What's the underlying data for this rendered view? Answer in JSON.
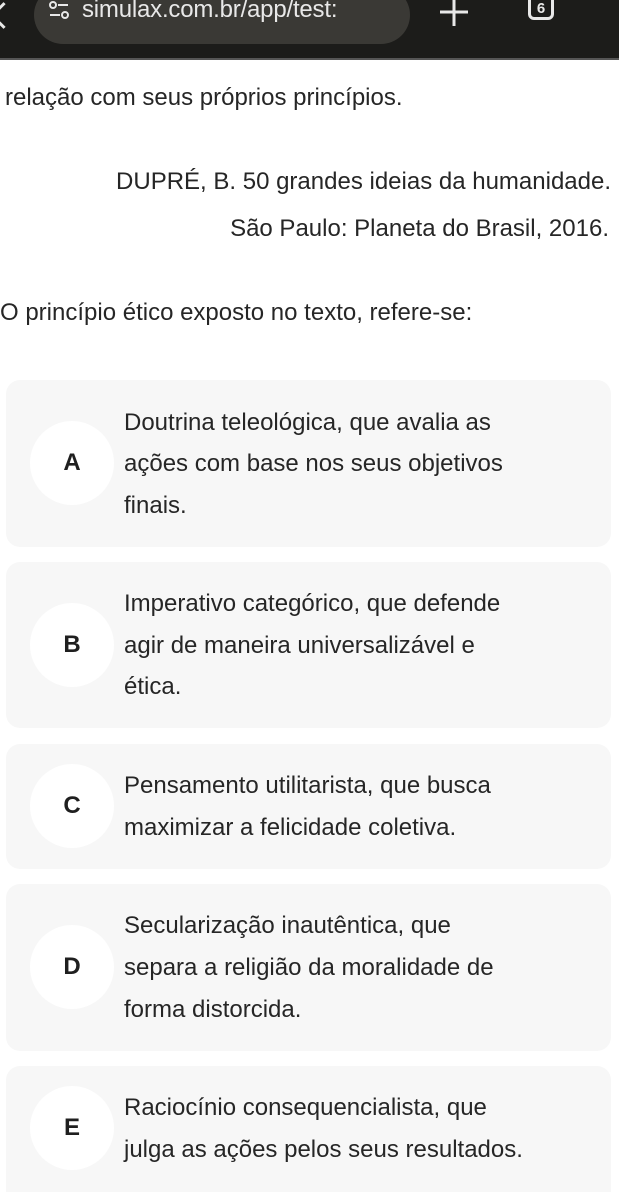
{
  "browser": {
    "url": "simulax.com.br/app/test:",
    "tab_count": "6",
    "tune_icon": "tune-icon",
    "plus_icon": "plus-icon",
    "tabs_icon": "tab-switcher-icon"
  },
  "passage": {
    "last_line": "relação com seus próprios princípios.",
    "citation_line1": "DUPRÉ, B. 50 grandes ideias da humanidade.",
    "citation_line2": "São Paulo: Planeta do Brasil, 2016."
  },
  "question": {
    "prompt": "O princípio ético exposto no texto, refere-se:"
  },
  "options": [
    {
      "letter": "A",
      "lines": [
        "Doutrina teleológica, que avalia as",
        "ações com base nos seus objetivos",
        "finais."
      ]
    },
    {
      "letter": "B",
      "lines": [
        "Imperativo categórico, que defende",
        "agir de maneira universalizável e",
        "ética."
      ]
    },
    {
      "letter": "C",
      "lines": [
        "Pensamento utilitarista, que busca",
        "maximizar a felicidade coletiva."
      ]
    },
    {
      "letter": "D",
      "lines": [
        "Secularização inautêntica, que",
        "separa a religião da moralidade de",
        "forma distorcida."
      ]
    },
    {
      "letter": "E",
      "lines": [
        "Raciocínio consequencialista, que",
        "julga as ações pelos seus resultados."
      ]
    }
  ]
}
